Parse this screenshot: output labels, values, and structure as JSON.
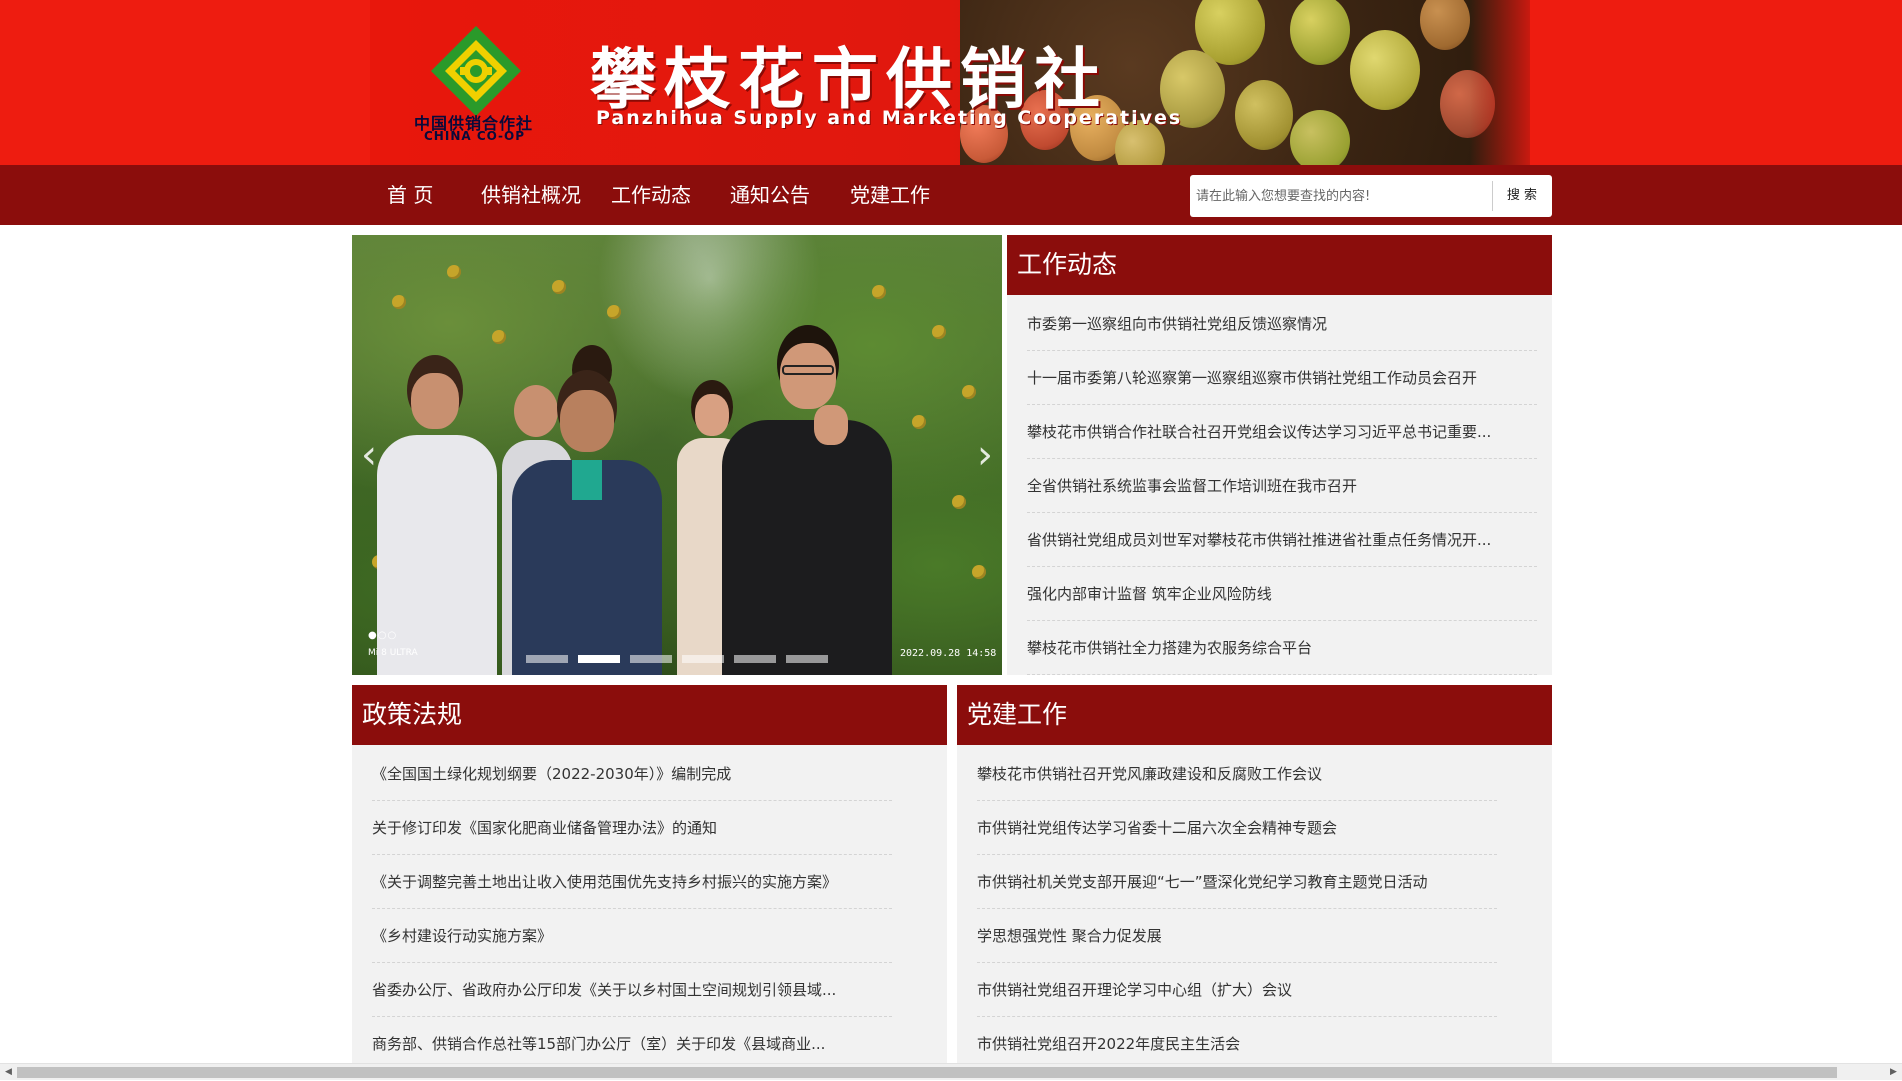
{
  "header": {
    "site_title": "攀枝花市供销社",
    "site_subtitle": "Panzhihua Supply and Marketing Cooperatives",
    "logo_cn": "中国供销合作社",
    "logo_en": "CHINA CO-OP"
  },
  "nav": {
    "items": [
      "首 页",
      "供销社概况",
      "工作动态",
      "通知公告",
      "党建工作"
    ]
  },
  "search": {
    "placeholder": "请在此输入您想要查找的内容!",
    "button_label": "搜 索"
  },
  "slider": {
    "prev_arrow": "‹",
    "next_arrow": "›",
    "photo_timestamp": "2022.09.28  14:58",
    "photo_brand": "Mi 8 ULTRA",
    "photo_dots": "●○○",
    "active_index": 1,
    "slide_count": 6
  },
  "work_news": {
    "title": "工作动态",
    "items": [
      "市委第一巡察组向市供销社党组反馈巡察情况",
      "十一届市委第八轮巡察第一巡察组巡察市供销社党组工作动员会召开",
      "攀枝花市供销合作社联合社召开党组会议传达学习习近平总书记重要...",
      "全省供销社系统监事会监督工作培训班在我市召开",
      "省供销社党组成员刘世军对攀枝花市供销社推进省社重点任务情况开...",
      "强化内部审计监督 筑牢企业风险防线",
      "攀枝花市供销社全力搭建为农服务综合平台"
    ]
  },
  "policy": {
    "title": "政策法规",
    "items": [
      "《全国国土绿化规划纲要（2022-2030年）》编制完成",
      "关于修订印发《国家化肥商业储备管理办法》的通知",
      "《关于调整完善土地出让收入使用范围优先支持乡村振兴的实施方案》",
      "《乡村建设行动实施方案》",
      "省委办公厅、省政府办公厅印发《关于以乡村国土空间规划引领县域...",
      "商务部、供销合作总社等15部门办公厅（室）关于印发《县域商业..."
    ]
  },
  "party": {
    "title": "党建工作",
    "items": [
      "攀枝花市供销社召开党风廉政建设和反腐败工作会议",
      "市供销社党组传达学习省委十二届六次全会精神专题会",
      "市供销社机关党支部开展迎“七一”暨深化党纪学习教育主题党日活动",
      "学思想强党性 聚合力促发展",
      "市供销社党组召开理论学习中心组（扩大）会议",
      "市供销社党组召开2022年度民主生活会"
    ]
  },
  "scrollbar": {
    "left_arrow": "◀",
    "right_arrow": "▶"
  },
  "colors": {
    "brand_red": "#ee1c10",
    "nav_dark_red": "#8b0d0c",
    "panel_bg": "#f2f2f2",
    "logo_green": "#2a9a2a",
    "logo_yellow": "#f0d000"
  }
}
